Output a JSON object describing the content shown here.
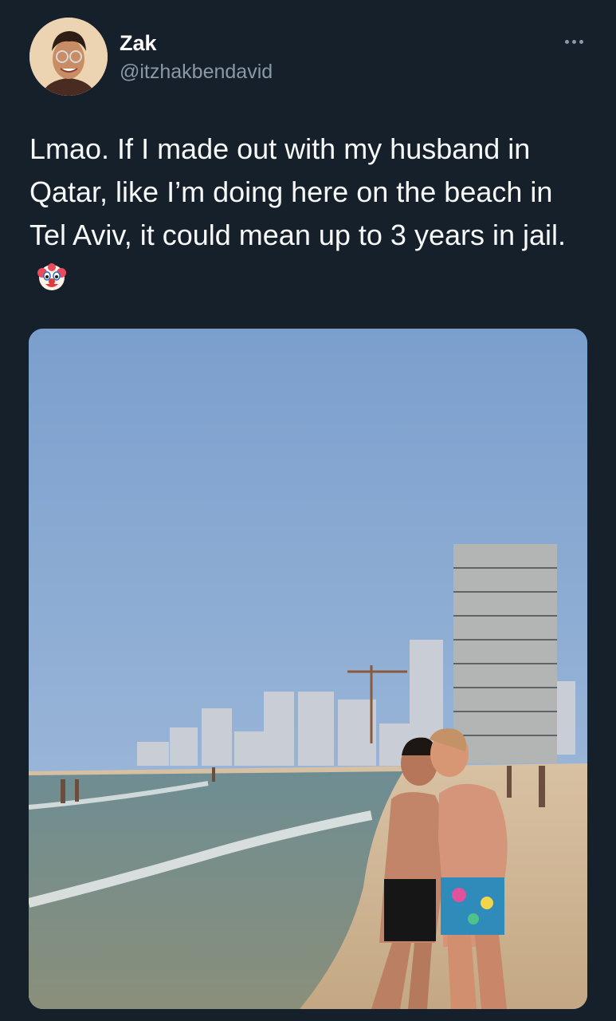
{
  "tweet": {
    "author": {
      "name": "Zak",
      "handle": "@itzhakbendavid"
    },
    "more_icon": "more-horizontal-icon",
    "text": "Lmao. If I made out with my husband in Qatar, like I’m doing here on the beach in Tel Aviv, it could mean up to 3 years in jail.",
    "emoji": "clown-face-icon"
  },
  "colors": {
    "background": "#15202b",
    "text": "#f7f9f9",
    "secondary": "#8b98a5"
  }
}
